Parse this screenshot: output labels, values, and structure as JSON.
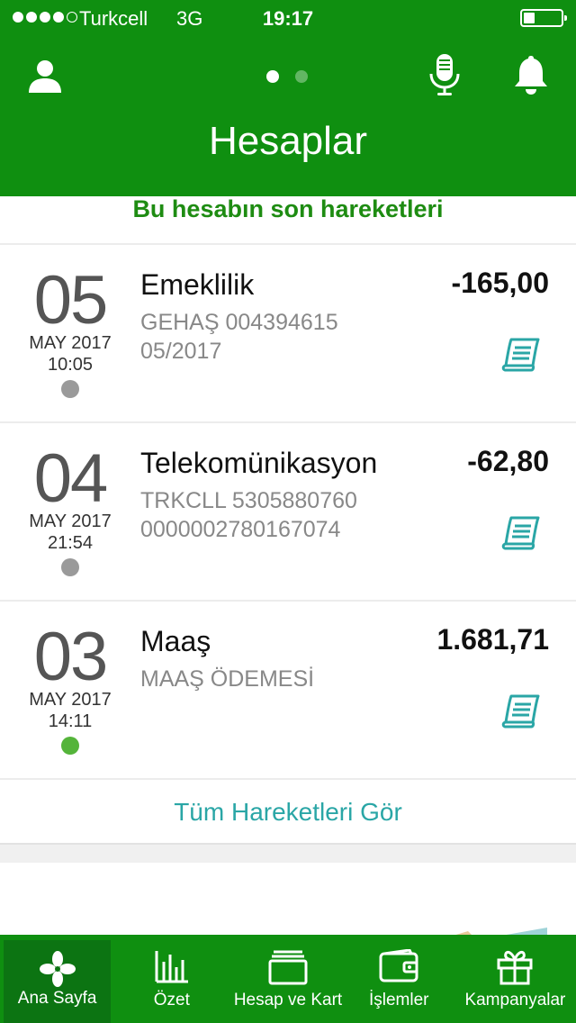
{
  "status_bar": {
    "carrier": "Turkcell",
    "network": "3G",
    "time": "19:17"
  },
  "header": {
    "title": "Hesaplar",
    "page_dots": 2,
    "active_dot": 1
  },
  "section_title": "Bu hesabın son hareketleri",
  "transactions": [
    {
      "day": "05",
      "month": "MAY 2017",
      "time": "10:05",
      "name": "Emeklilik",
      "desc1": "GEHAŞ 004394615",
      "desc2": "05/2017",
      "amount": "-165,00",
      "status": "grey"
    },
    {
      "day": "04",
      "month": "MAY 2017",
      "time": "21:54",
      "name": "Telekomünikasyon",
      "desc1": "TRKCLL 5305880760",
      "desc2": "0000002780167074",
      "amount": "-62,80",
      "status": "grey"
    },
    {
      "day": "03",
      "month": "MAY 2017",
      "time": "14:11",
      "name": "Maaş",
      "desc1": "MAAŞ ÖDEMESİ",
      "desc2": "",
      "amount": "1.681,71",
      "status": "green"
    }
  ],
  "see_all": "Tüm Hareketleri Gör",
  "tabs": [
    {
      "label": "Ana Sayfa",
      "icon": "flower-icon",
      "active": true
    },
    {
      "label": "Özet",
      "icon": "bar-chart-icon",
      "active": false
    },
    {
      "label": "Hesap ve Kart",
      "icon": "cards-icon",
      "active": false
    },
    {
      "label": "İşlemler",
      "icon": "wallet-icon",
      "active": false
    },
    {
      "label": "Kampanyalar",
      "icon": "gift-icon",
      "active": false
    }
  ],
  "colors": {
    "brand_green": "#0f8f10",
    "section_title": "#1e8c12",
    "link_teal": "#2aa6a6",
    "status_grey": "#9a9a9a",
    "status_green": "#54b43a"
  }
}
